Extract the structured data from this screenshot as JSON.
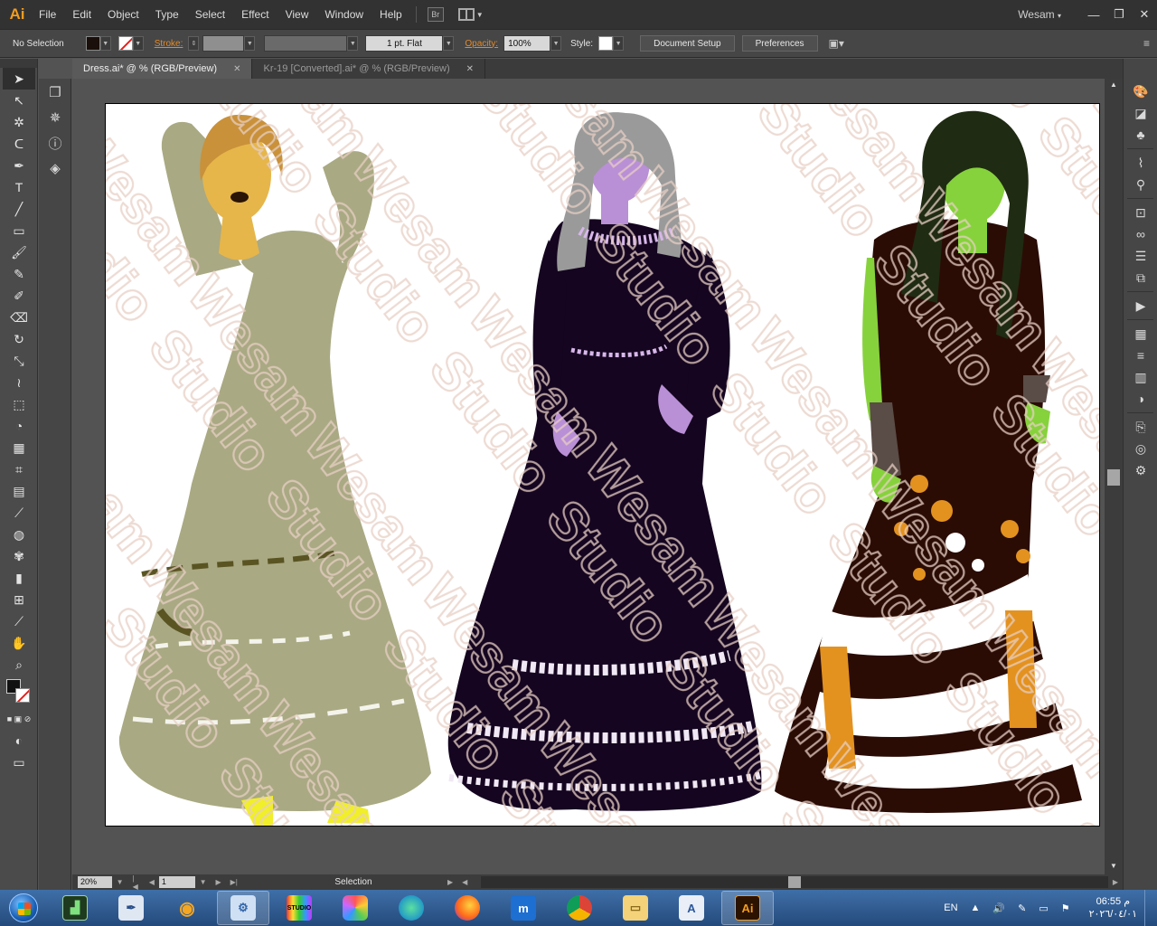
{
  "menubar": {
    "logo": "Ai",
    "items": [
      "File",
      "Edit",
      "Object",
      "Type",
      "Select",
      "Effect",
      "View",
      "Window",
      "Help"
    ],
    "bridge_label": "Br",
    "user": "Wesam",
    "window_buttons": [
      "—",
      "❐",
      "✕"
    ]
  },
  "controlbar": {
    "selection_label": "No Selection",
    "fill_color": "#1a0f0a",
    "stroke_label": "Stroke:",
    "brush_value": "1 pt. Flat",
    "opacity_label": "Opacity:",
    "opacity_value": "100%",
    "style_label": "Style:",
    "document_setup": "Document Setup",
    "preferences": "Preferences"
  },
  "tabs": [
    {
      "label": "Dress.ai* @ % (RGB/Preview)",
      "active": true
    },
    {
      "label": "Kr-19 [Converted].ai* @ % (RGB/Preview)",
      "active": false
    }
  ],
  "tools": [
    "selection-tool",
    "direct-selection-tool",
    "magic-wand-tool",
    "lasso-tool",
    "pen-tool",
    "type-tool",
    "line-tool",
    "rectangle-tool",
    "paintbrush-tool",
    "pencil-tool",
    "blob-brush-tool",
    "eraser-tool",
    "rotate-tool",
    "scale-tool",
    "warp-tool",
    "free-transform-tool",
    "shape-builder-tool",
    "perspective-grid-tool",
    "mesh-tool",
    "gradient-tool",
    "eyedropper-tool",
    "blend-tool",
    "symbol-sprayer-tool",
    "column-graph-tool",
    "artboard-tool",
    "slice-tool",
    "hand-tool",
    "zoom-tool"
  ],
  "statusbar": {
    "zoom": "20%",
    "page": "1",
    "status_text": "Selection"
  },
  "artwork": {
    "watermark": "Wesam Studio",
    "colors": {
      "dress_left": "#a9a983",
      "dress_middle": "#150520",
      "dress_right": "#2a0c05",
      "skin_left": "#e6b64a",
      "skin_middle": "#b98fd6",
      "skin_right": "#86d23c",
      "accent_orange": "#e39220"
    }
  },
  "taskbar": {
    "apps": [
      "task-manager",
      "pen-app",
      "eye-app",
      "control-panel",
      "studio-app",
      "paint-app",
      "edge-browser",
      "firefox-browser",
      "maxthon-browser",
      "chrome-browser",
      "file-explorer",
      "document-viewer",
      "illustrator"
    ],
    "studio_label": "STUDIO",
    "ai_label": "Ai",
    "language": "EN",
    "time": "06:55 م",
    "date": "٢٠٢٦/٠٤/٠١"
  }
}
